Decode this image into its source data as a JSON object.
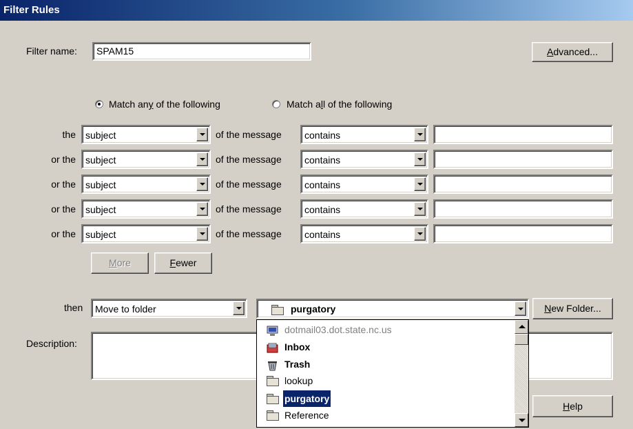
{
  "window": {
    "title": "Filter Rules"
  },
  "filter_name": {
    "label": "Filter name:",
    "value": "SPAM15"
  },
  "advanced_button": {
    "label": "Advanced..."
  },
  "match": {
    "any_label": "Match any of the following",
    "all_label": "Match all of the following",
    "selected": "any"
  },
  "rules": {
    "of_the_message": "of the message",
    "rows": [
      {
        "prefix": "the",
        "field": "subject",
        "operator": "contains",
        "value": ""
      },
      {
        "prefix": "or the",
        "field": "subject",
        "operator": "contains",
        "value": ""
      },
      {
        "prefix": "or the",
        "field": "subject",
        "operator": "contains",
        "value": ""
      },
      {
        "prefix": "or the",
        "field": "subject",
        "operator": "contains",
        "value": ""
      },
      {
        "prefix": "or the",
        "field": "subject",
        "operator": "contains",
        "value": ""
      }
    ]
  },
  "more_button": {
    "label": "More",
    "enabled": false
  },
  "fewer_button": {
    "label": "Fewer"
  },
  "then": {
    "label": "then",
    "action": "Move to folder",
    "folder": "purgatory"
  },
  "new_folder_button": {
    "label": "New Folder..."
  },
  "description": {
    "label": "Description:",
    "value": ""
  },
  "help_button": {
    "label": "Help"
  },
  "folder_list": {
    "items": [
      {
        "label": "dotmail03.dot.state.nc.us",
        "icon": "server-icon",
        "bold": false,
        "disabled": true
      },
      {
        "label": "Inbox",
        "icon": "inbox-icon",
        "bold": true
      },
      {
        "label": "Trash",
        "icon": "trash-icon",
        "bold": true
      },
      {
        "label": "lookup",
        "icon": "folder-icon",
        "bold": false
      },
      {
        "label": "purgatory",
        "icon": "folder-icon",
        "bold": true,
        "selected": true
      },
      {
        "label": "Reference",
        "icon": "folder-icon",
        "bold": false
      }
    ]
  },
  "colors": {
    "title_start": "#0a246a",
    "title_end": "#a6caf0",
    "face": "#d4d0c8",
    "selection": "#0a246a"
  }
}
